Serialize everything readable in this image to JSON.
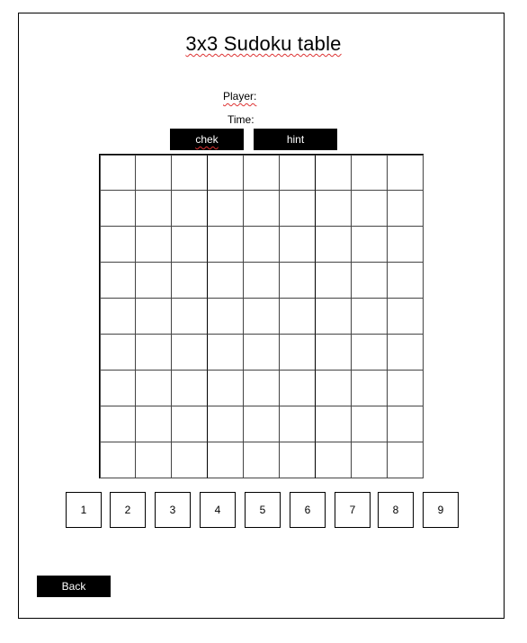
{
  "title": "3x3 Sudoku table",
  "player_label": "Player:",
  "time_label": "Time:",
  "buttons": {
    "check": "chek",
    "hint": "hint",
    "back": "Back"
  },
  "board": {
    "rows": 9,
    "cols": 9,
    "cells": [
      [
        "",
        "",
        "",
        "",
        "",
        "",
        "",
        "",
        ""
      ],
      [
        "",
        "",
        "",
        "",
        "",
        "",
        "",
        "",
        ""
      ],
      [
        "",
        "",
        "",
        "",
        "",
        "",
        "",
        "",
        ""
      ],
      [
        "",
        "",
        "",
        "",
        "",
        "",
        "",
        "",
        ""
      ],
      [
        "",
        "",
        "",
        "",
        "",
        "",
        "",
        "",
        ""
      ],
      [
        "",
        "",
        "",
        "",
        "",
        "",
        "",
        "",
        ""
      ],
      [
        "",
        "",
        "",
        "",
        "",
        "",
        "",
        "",
        ""
      ],
      [
        "",
        "",
        "",
        "",
        "",
        "",
        "",
        "",
        ""
      ],
      [
        "",
        "",
        "",
        "",
        "",
        "",
        "",
        "",
        ""
      ]
    ]
  },
  "number_buttons": [
    "1",
    "2",
    "3",
    "4",
    "5",
    "6",
    "7",
    "8",
    "9"
  ]
}
